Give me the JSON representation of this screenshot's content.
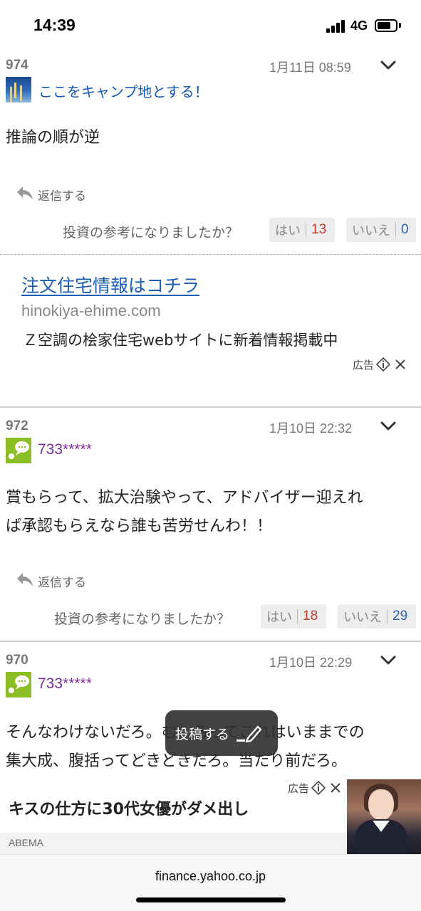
{
  "status_bar": {
    "time": "14:39",
    "network": "4G"
  },
  "helpful_question": "投資の参考になりましたか？",
  "reply_label": "返信する",
  "vote_yes_label": "はい",
  "vote_no_label": "いいえ",
  "posts": [
    {
      "number": "974",
      "date": "1月11日 08:59",
      "username": "ここをキャンプ地とする！",
      "body": "推論の順が逆",
      "yes_count": "13",
      "no_count": "0"
    },
    {
      "number": "972",
      "date": "1月10日 22:32",
      "username": "733*****",
      "body_line1": "賞もらって、拡大治験やって、アドバイザー迎えれ",
      "body_line2": "ば承認もらえなら誰も苦労せんわ！！",
      "yes_count": "18",
      "no_count": "29"
    },
    {
      "number": "970",
      "date": "1月10日 22:29",
      "username": "733*****",
      "body_line1": "そんなわけないだろ。むしろってこれはいままでの",
      "body_line2": "集大成、腹括ってどきどきだろ。当たり前だろ。"
    }
  ],
  "ad_text": {
    "title": "注文住宅情報はコチラ",
    "domain": "hinokiya-ehime.com",
    "description": "Ｚ空調の桧家住宅webサイトに新着情報掲載中",
    "marker": "広告"
  },
  "ad_banner": {
    "title": "キスの仕方に30代女優がダメ出し",
    "source": "ABEMA",
    "marker": "広告"
  },
  "fab": {
    "label": "投稿する"
  },
  "browser": {
    "url": "finance.yahoo.co.jp"
  },
  "colors": {
    "link_blue": "#1558b0",
    "username_purple": "#7b2fa0",
    "yes_red": "#c0392b",
    "no_blue": "#2e5fb5",
    "avatar_green": "#8cbf26"
  }
}
